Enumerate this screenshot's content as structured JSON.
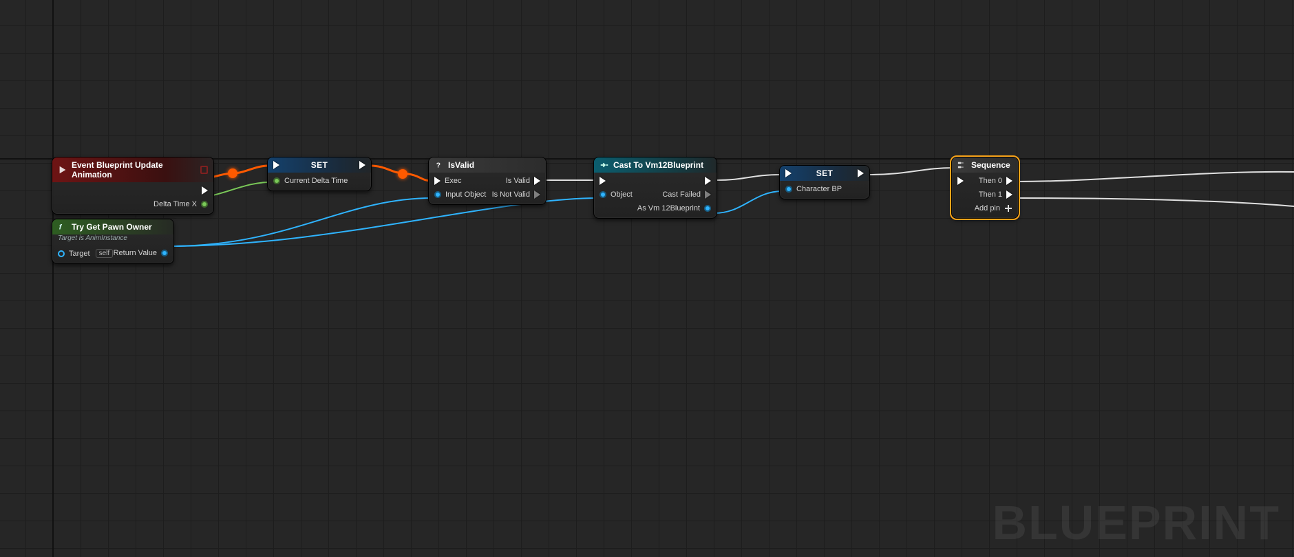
{
  "watermark": "BLUEPRINT",
  "nodes": {
    "event": {
      "title": "Event Blueprint Update Animation",
      "pin_delta": "Delta Time X"
    },
    "set1": {
      "title": "SET",
      "pin_var": "Current Delta Time"
    },
    "isvalid": {
      "title": "IsValid",
      "pin_exec": "Exec",
      "pin_input": "Input Object",
      "pin_valid": "Is Valid",
      "pin_invalid": "Is Not Valid"
    },
    "pawn": {
      "title": "Try Get Pawn Owner",
      "subtitle": "Target is AnimInstance",
      "pin_target": "Target",
      "self": "self",
      "pin_return": "Return Value"
    },
    "cast": {
      "title": "Cast To Vm12Blueprint",
      "pin_object": "Object",
      "pin_failed": "Cast Failed",
      "pin_as": "As Vm 12Blueprint"
    },
    "set2": {
      "title": "SET",
      "pin_var": "Character BP"
    },
    "seq": {
      "title": "Sequence",
      "then0": "Then 0",
      "then1": "Then 1",
      "add": "Add pin"
    }
  }
}
